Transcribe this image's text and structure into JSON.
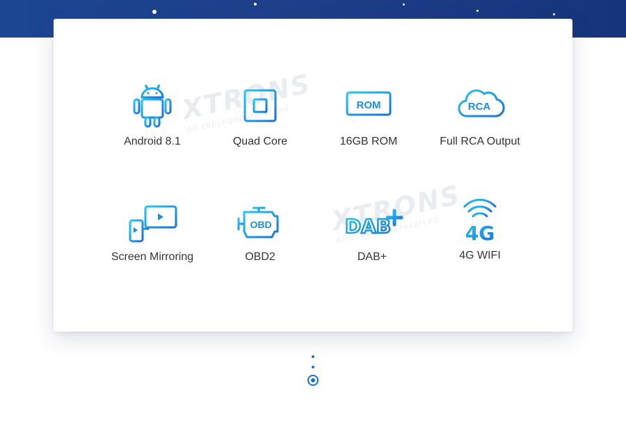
{
  "accent_color": "#1aa0ea",
  "watermark": {
    "brand": "XTRONS",
    "tagline": "All copyrights reserved"
  },
  "features": [
    {
      "label": "Android 8.1",
      "icon": "android-icon"
    },
    {
      "label": "Quad Core",
      "icon": "cpu-chip-icon"
    },
    {
      "label": "16GB ROM",
      "icon": "rom-memory-icon",
      "icon_text": "ROM"
    },
    {
      "label": "Full RCA Output",
      "icon": "rca-cloud-icon",
      "icon_text": "RCA"
    },
    {
      "label": "Screen Mirroring",
      "icon": "screen-mirroring-icon"
    },
    {
      "label": "OBD2",
      "icon": "obd-engine-icon",
      "icon_text": "OBD"
    },
    {
      "label": "DAB+",
      "icon": "dab-plus-icon",
      "icon_text": "DAB"
    },
    {
      "label": "4G WIFI",
      "icon": "wifi-4g-icon",
      "icon_text": "4G"
    }
  ],
  "pager": {
    "pages": 3,
    "active_index": 2
  }
}
